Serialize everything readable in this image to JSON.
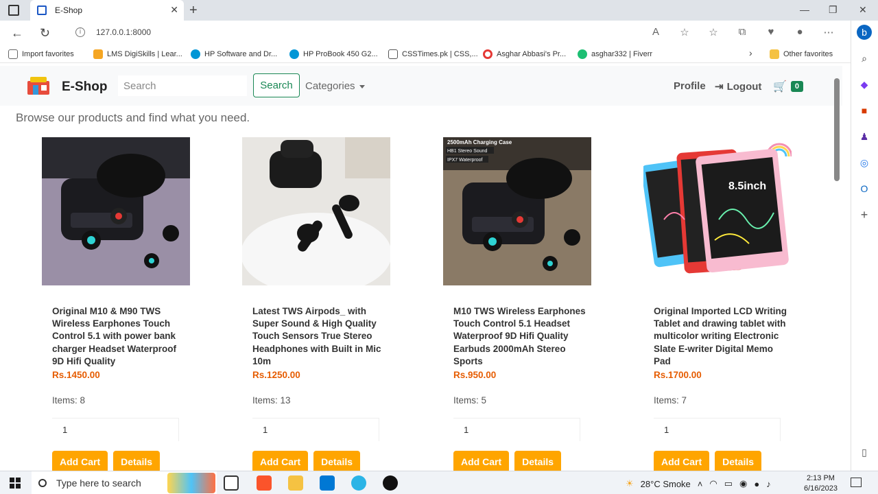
{
  "browser": {
    "tab_title": "E-Shop",
    "url": "127.0.0.1:8000",
    "favorites": [
      {
        "label": "Import favorites",
        "color": "#666666"
      },
      {
        "label": "LMS DigiSkills | Lear...",
        "color": "#f5a623"
      },
      {
        "label": "HP Software and Dr...",
        "color": "#0096d6"
      },
      {
        "label": "HP ProBook 450 G2...",
        "color": "#0096d6"
      },
      {
        "label": "CSSTimes.pk | CSS,...",
        "color": "#555555"
      },
      {
        "label": "Asghar Abbasi's Pr...",
        "color": "#e53935"
      },
      {
        "label": "asghar332 | Fiverr",
        "color": "#1dbf73"
      }
    ],
    "other_favorites": "Other favorites"
  },
  "navbar": {
    "brand": "E-Shop",
    "search_placeholder": "Search",
    "search_button": "Search",
    "categories": "Categories",
    "profile": "Profile",
    "logout": "Logout",
    "cart_count": "0"
  },
  "tagline": "Browse our products and find what you need.",
  "products": [
    {
      "title": "Original M10 & M90 TWS Wireless Earphones Touch Control 5.1 with power bank charger Headset Waterproof 9D Hifi Quality",
      "price": "Rs.1450.00",
      "items": "Items: 8",
      "qty": "1",
      "add_cart": "Add Cart",
      "details": "Details"
    },
    {
      "title": "Latest TWS Airpods_ with Super Sound & High Quality Touch Sensors True Stereo Headphones with Built in Mic 10m",
      "price": "Rs.1250.00",
      "items": "Items: 13",
      "qty": "1",
      "add_cart": "Add Cart",
      "details": "Details"
    },
    {
      "title": "M10 TWS Wireless Earphones Touch Control 5.1 Headset Waterproof 9D Hifi Quality Earbuds 2000mAh Stereo Sports",
      "price": "Rs.950.00",
      "items": "Items: 5",
      "qty": "1",
      "add_cart": "Add Cart",
      "details": "Details"
    },
    {
      "title": "Original Imported LCD Writing Tablet and drawing tablet with multicolor writing Electronic Slate E-writer Digital Memo Pad",
      "price": "Rs.1700.00",
      "items": "Items: 7",
      "qty": "1",
      "add_cart": "Add Cart",
      "details": "Details"
    }
  ],
  "image_overlays": {
    "p3_line1": "2500mAh Charging Case",
    "p3_line2": "HB1 Stereo Sound",
    "p3_line3": "IPX7 Waterproof",
    "p4_size": "8.5inch"
  },
  "taskbar": {
    "search_placeholder": "Type here to search",
    "weather": "28°C  Smoke",
    "time": "2:13 PM",
    "date": "6/16/2023"
  }
}
